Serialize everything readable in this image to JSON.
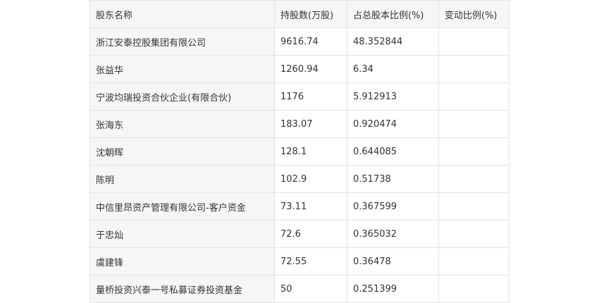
{
  "table": {
    "headers": [
      "股东名称",
      "持股数(万股)",
      "占总股本比例(%)",
      "变动比例(%)"
    ],
    "rows": [
      [
        "浙江安泰控股集团有限公司",
        "9616.74",
        "48.352844",
        ""
      ],
      [
        "张益华",
        "1260.94",
        "6.34",
        ""
      ],
      [
        "宁波均瑞投资合伙企业(有限合伙)",
        "1176",
        "5.912913",
        ""
      ],
      [
        "张海东",
        "183.07",
        "0.920474",
        ""
      ],
      [
        "沈朝晖",
        "128.1",
        "0.644085",
        ""
      ],
      [
        "陈明",
        "102.9",
        "0.51738",
        ""
      ],
      [
        "中信里昂资产管理有限公司-客户资金",
        "73.11",
        "0.367599",
        ""
      ],
      [
        "于忠灿",
        "72.6",
        "0.365032",
        ""
      ],
      [
        "虞建锋",
        "72.55",
        "0.36478",
        ""
      ],
      [
        "量桥投资兴泰一号私募证券投资基金",
        "50",
        "0.251399",
        ""
      ]
    ]
  }
}
